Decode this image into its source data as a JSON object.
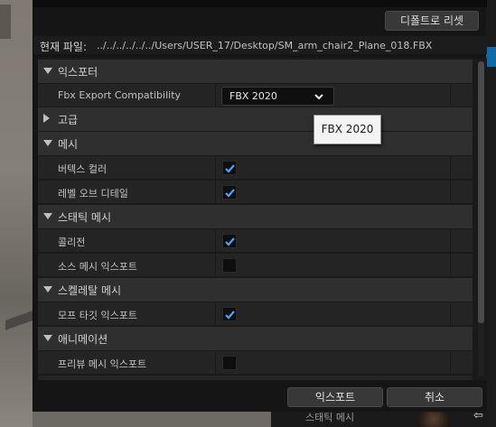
{
  "window": {
    "reset_button": "디폴트로 리셋",
    "path_label": "현재 파일:",
    "path_value": "../../../../../../Users/USER_17/Desktop/SM_arm_chair2_Plane_018.FBX"
  },
  "sections": {
    "exporter": {
      "label": "익스포터",
      "compat_label": "Fbx Export Compatibility",
      "compat_value": "FBX 2020"
    },
    "advanced": {
      "label": "고급"
    },
    "mesh": {
      "label": "메시",
      "vertex_color": "버텍스 컬러",
      "lod": "레벨 오브 디테일",
      "vertex_color_checked": true,
      "lod_checked": true
    },
    "static_mesh": {
      "label": "스태틱 메시",
      "collision": "콜리전",
      "source_mesh": "소스 메시 익스포트",
      "collision_checked": true,
      "source_mesh_checked": false
    },
    "skeletal_mesh": {
      "label": "스켈레탈 메시",
      "morph": "모프 타깃 익스포트",
      "morph_checked": true
    },
    "animation": {
      "label": "애니메이션",
      "preview_mesh": "프리뷰 메시 익스포트",
      "preview_mesh_checked": false
    }
  },
  "tooltip": {
    "text": "FBX 2020"
  },
  "footer": {
    "export_button": "익스포트",
    "cancel_button": "취소"
  },
  "background": {
    "asset_label": "스태틱 메시"
  },
  "colors": {
    "accent": "#0f6aa6",
    "check": "#4aa3ff",
    "panel": "#242424",
    "category": "#2f2f2f"
  }
}
